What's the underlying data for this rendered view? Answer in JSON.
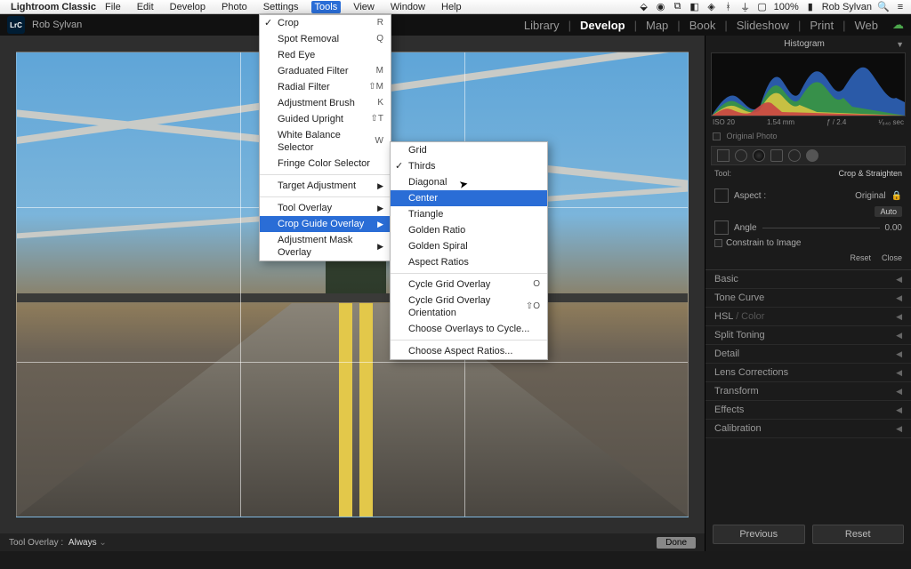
{
  "mac_menubar": {
    "app": "Lightroom Classic",
    "items": [
      "File",
      "Edit",
      "Develop",
      "Photo",
      "Settings",
      "Tools",
      "View",
      "Window",
      "Help"
    ],
    "active": "Tools",
    "battery": "100%",
    "user": "Rob Sylvan"
  },
  "identity": {
    "logo": "LrC",
    "user": "Rob Sylvan"
  },
  "modules": {
    "items": [
      "Library",
      "Develop",
      "Map",
      "Book",
      "Slideshow",
      "Print",
      "Web"
    ],
    "active": "Develop"
  },
  "tools_menu": {
    "items": [
      {
        "label": "Crop",
        "shortcut": "R",
        "checked": true
      },
      {
        "label": "Spot Removal",
        "shortcut": "Q"
      },
      {
        "label": "Red Eye",
        "shortcut": ""
      },
      {
        "label": "Graduated Filter",
        "shortcut": "M"
      },
      {
        "label": "Radial Filter",
        "shortcut": "⇧M"
      },
      {
        "label": "Adjustment Brush",
        "shortcut": "K"
      },
      {
        "label": "Guided Upright",
        "shortcut": "⇧T"
      },
      {
        "label": "White Balance Selector",
        "shortcut": "W"
      },
      {
        "label": "Fringe Color Selector",
        "shortcut": ""
      },
      {
        "divider": true
      },
      {
        "label": "Target Adjustment",
        "submenu": true
      },
      {
        "divider": true
      },
      {
        "label": "Tool Overlay",
        "submenu": true
      },
      {
        "label": "Crop Guide Overlay",
        "submenu": true,
        "highlight": true
      },
      {
        "label": "Adjustment Mask Overlay",
        "submenu": true
      }
    ]
  },
  "crop_guide_submenu": {
    "items": [
      {
        "label": "Grid"
      },
      {
        "label": "Thirds",
        "checked": true
      },
      {
        "label": "Diagonal"
      },
      {
        "label": "Center",
        "highlight": true
      },
      {
        "label": "Triangle"
      },
      {
        "label": "Golden Ratio"
      },
      {
        "label": "Golden Spiral"
      },
      {
        "label": "Aspect Ratios"
      },
      {
        "divider": true
      },
      {
        "label": "Cycle Grid Overlay",
        "shortcut": "O"
      },
      {
        "label": "Cycle Grid Overlay Orientation",
        "shortcut": "⇧O"
      },
      {
        "label": "Choose Overlays to Cycle..."
      },
      {
        "divider": true
      },
      {
        "label": "Choose Aspect Ratios..."
      }
    ]
  },
  "histogram": {
    "title": "Histogram",
    "iso": "ISO 20",
    "focal": "1.54 mm",
    "aperture": "ƒ / 2.4",
    "shutter": "¹⁄₈₄₀ sec",
    "original_photo": "Original Photo"
  },
  "crop_panel": {
    "tool_label": "Tool:",
    "tool_value": "Crop & Straighten",
    "aspect_label": "Aspect :",
    "aspect_value": "Original",
    "auto": "Auto",
    "angle_label": "Angle",
    "angle_value": "0.00",
    "constrain": "Constrain to Image",
    "reset": "Reset",
    "close": "Close"
  },
  "panels": [
    "Basic",
    "Tone Curve",
    "HSL / Color",
    "Split Toning",
    "Detail",
    "Lens Corrections",
    "Transform",
    "Effects",
    "Calibration"
  ],
  "footer": {
    "tool_overlay_label": "Tool Overlay :",
    "tool_overlay_value": "Always",
    "done": "Done"
  },
  "bottom_buttons": {
    "previous": "Previous",
    "reset": "Reset"
  }
}
